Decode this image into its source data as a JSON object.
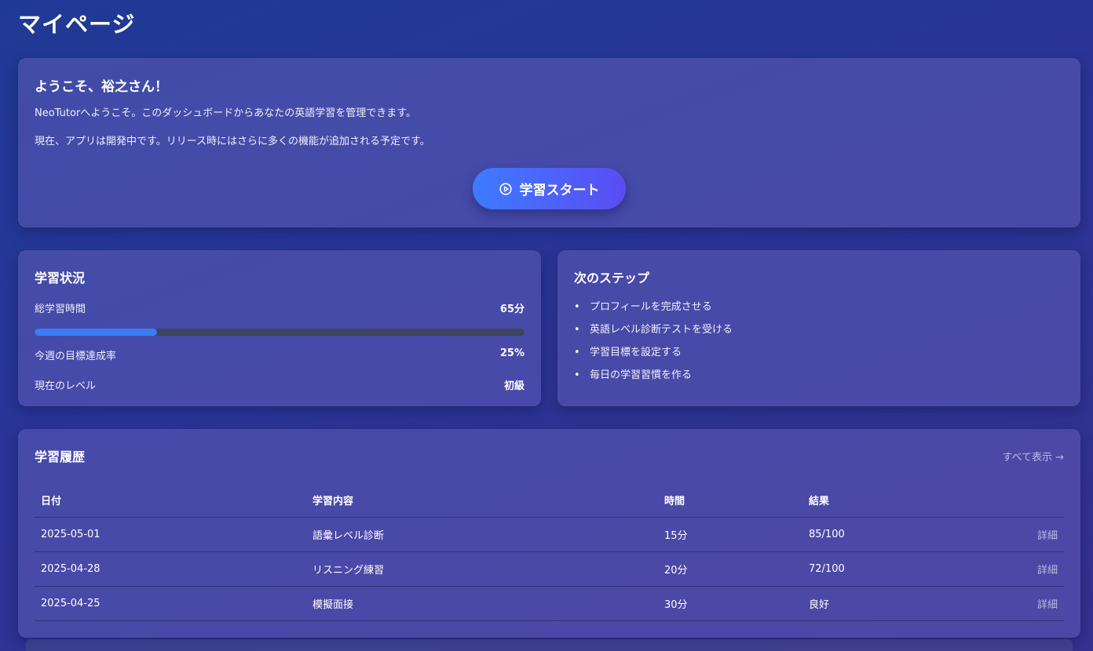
{
  "page": {
    "title": "マイページ"
  },
  "welcome": {
    "heading": "ようこそ、裕之さん！",
    "line1": "NeoTutorへようこそ。このダッシュボードからあなたの英語学習を管理できます。",
    "line2": "現在、アプリは開発中です。リリース時にはさらに多くの機能が追加される予定です。",
    "start_button": "学習スタート",
    "start_icon": "play-circle-icon"
  },
  "status": {
    "heading": "学習状況",
    "total_time_label": "総学習時間",
    "total_time_value": "65分",
    "weekly_goal_label": "今週の目標達成率",
    "weekly_goal_value": "25%",
    "weekly_goal_fraction": 0.25,
    "level_label": "現在のレベル",
    "level_value": "初級",
    "accent_color": "#3b7df5"
  },
  "next_steps": {
    "heading": "次のステップ",
    "items": [
      "プロフィールを完成させる",
      "英語レベル診断テストを受ける",
      "学習目標を設定する",
      "毎日の学習習慣を作る"
    ]
  },
  "history": {
    "heading": "学習履歴",
    "view_all": "すべて表示 →",
    "columns": [
      "日付",
      "学習内容",
      "時間",
      "結果"
    ],
    "rows": [
      {
        "date": "2025-05-01",
        "content": "語彙レベル診断",
        "time": "15分",
        "result": "85/100",
        "action": "詳細"
      },
      {
        "date": "2025-04-28",
        "content": "リスニング練習",
        "time": "20分",
        "result": "72/100",
        "action": "詳細"
      },
      {
        "date": "2025-04-25",
        "content": "模擬面接",
        "time": "30分",
        "result": "良好",
        "action": "詳細"
      }
    ]
  }
}
